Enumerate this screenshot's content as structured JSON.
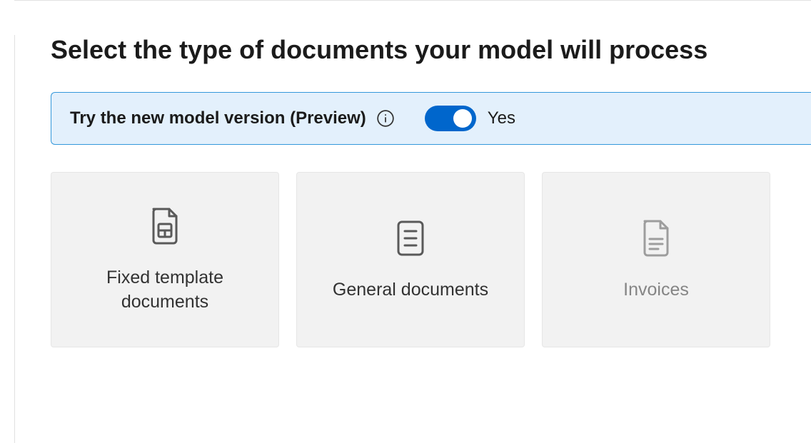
{
  "header": {
    "title": "Select the type of documents your model will process"
  },
  "previewBanner": {
    "label": "Try the new model version (Preview)",
    "toggleState": "Yes"
  },
  "cards": [
    {
      "title": "Fixed template documents"
    },
    {
      "title": "General documents"
    },
    {
      "title": "Invoices"
    }
  ]
}
